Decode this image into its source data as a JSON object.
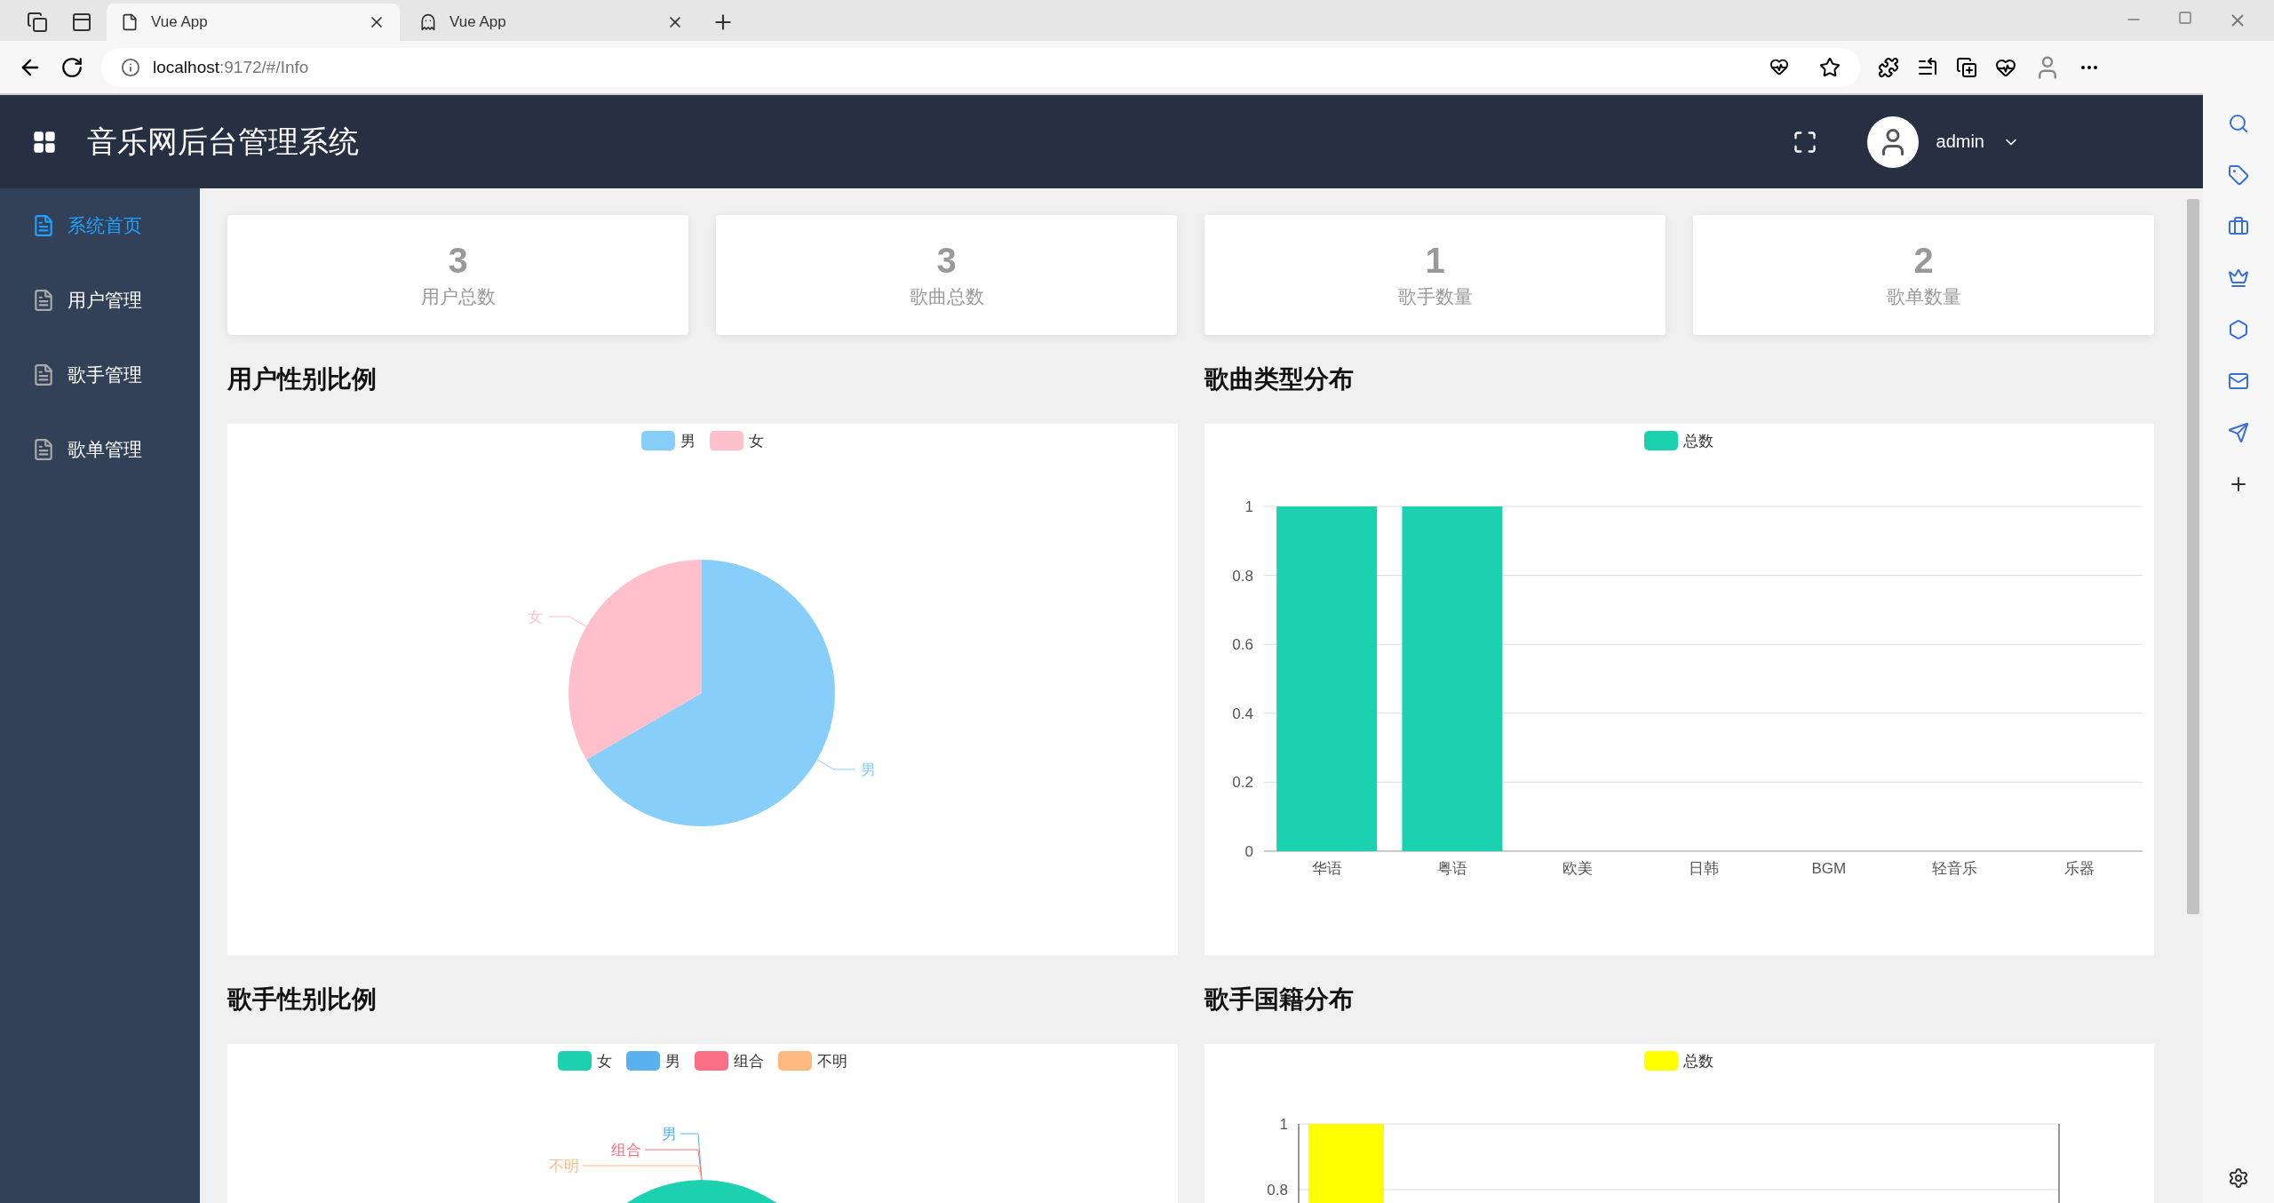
{
  "browser": {
    "tabs": [
      {
        "title": "Vue App",
        "selected": true
      },
      {
        "title": "Vue App",
        "selected": false
      }
    ],
    "url": {
      "host": "localhost",
      "path": ":9172/#/Info"
    }
  },
  "header": {
    "title": "音乐网后台管理系统",
    "user": "admin"
  },
  "sidebar": {
    "items": [
      {
        "label": "系统首页",
        "selected": true
      },
      {
        "label": "用户管理",
        "selected": false
      },
      {
        "label": "歌手管理",
        "selected": false
      },
      {
        "label": "歌单管理",
        "selected": false
      }
    ]
  },
  "stats": [
    {
      "value": "3",
      "label": "用户总数"
    },
    {
      "value": "3",
      "label": "歌曲总数"
    },
    {
      "value": "1",
      "label": "歌手数量"
    },
    {
      "value": "2",
      "label": "歌单数量"
    }
  ],
  "panels": [
    {
      "title": "用户性别比例",
      "legend": [
        {
          "label": "男",
          "color": "#87cefa"
        },
        {
          "label": "女",
          "color": "#ffc0cb"
        }
      ],
      "chart_data": {
        "type": "pie",
        "categories": [
          "男",
          "女"
        ],
        "series": [
          {
            "values": [
              66.67,
              33.33
            ]
          }
        ]
      }
    },
    {
      "title": "歌曲类型分布",
      "chart_data": {
        "type": "bar",
        "grid": true,
        "categories": [
          "华语",
          "粤语",
          "欧美",
          "日韩",
          "BGM",
          "轻音乐",
          "乐器"
        ],
        "ylim": [
          0,
          1
        ],
        "yticks": [
          0,
          0.2,
          0.4,
          0.6,
          0.8,
          1
        ],
        "series": [
          {
            "name": "总数",
            "color": "#1bd1b0",
            "values": [
              1,
              1,
              0,
              0,
              0,
              0,
              0
            ]
          }
        ]
      }
    },
    {
      "title": "歌手性别比例",
      "legend": [
        {
          "label": "女",
          "color": "#1bd1b0"
        },
        {
          "label": "男",
          "color": "#5ab1ef"
        },
        {
          "label": "组合",
          "color": "#fa6e86"
        },
        {
          "label": "不明",
          "color": "#ffb980"
        }
      ],
      "pie_labels": [
        {
          "text": "男",
          "color": "#5ab1ef"
        },
        {
          "text": "组合",
          "color": "#fa6e86"
        },
        {
          "text": "不明",
          "color": "#ffb980"
        }
      ]
    },
    {
      "title": "歌手国籍分布",
      "legend": [
        {
          "label": "总数",
          "color": "#ffff00"
        }
      ],
      "axis_labels": [
        "1",
        "0.8"
      ]
    }
  ]
}
